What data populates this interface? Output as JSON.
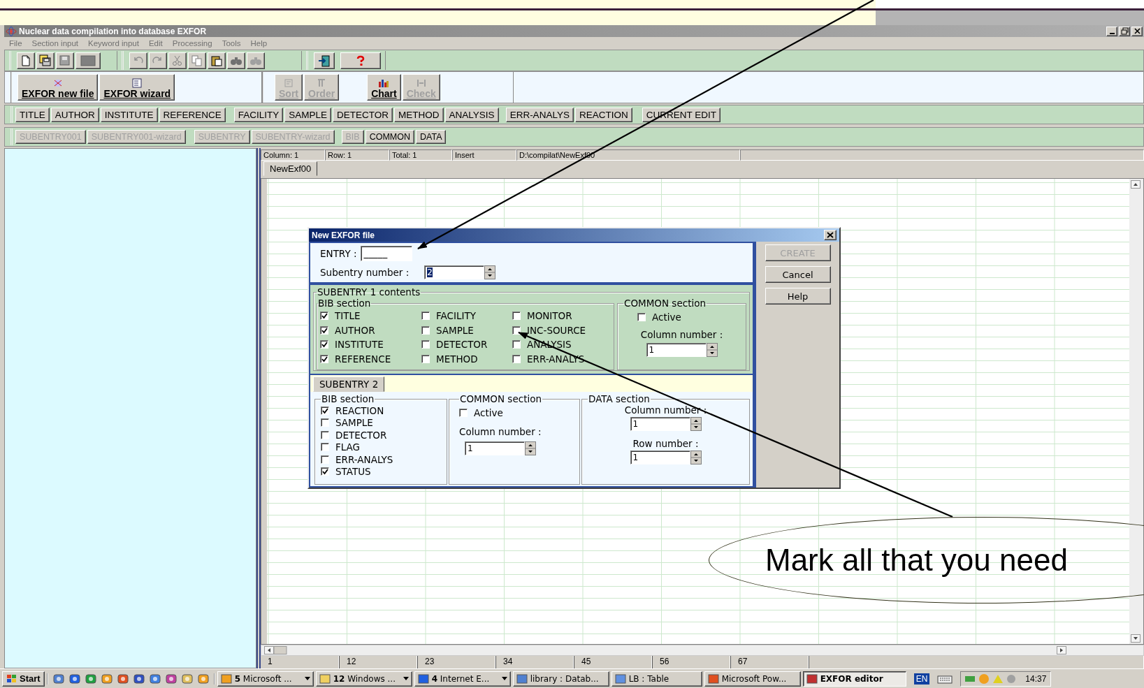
{
  "window": {
    "title": "Nuclear data compilation into database EXFOR"
  },
  "menu": [
    "File",
    "Section input",
    "Keyword input",
    "Edit",
    "Processing",
    "Tools",
    "Help"
  ],
  "main_toolbar": [
    {
      "label": "EXFOR new file",
      "disabled": false
    },
    {
      "label": "EXFOR wizard",
      "disabled": false
    },
    {
      "label": "Sort",
      "disabled": true
    },
    {
      "label": "Order",
      "disabled": true
    },
    {
      "label": "Chart",
      "disabled": false
    },
    {
      "label": "Check",
      "disabled": true
    }
  ],
  "section_buttons": [
    {
      "label": "TITLE",
      "disabled": false
    },
    {
      "label": "AUTHOR",
      "disabled": false
    },
    {
      "label": "INSTITUTE",
      "disabled": false
    },
    {
      "label": "REFERENCE",
      "disabled": false
    },
    {
      "label": "FACILITY",
      "disabled": false
    },
    {
      "label": "SAMPLE",
      "disabled": false
    },
    {
      "label": "DETECTOR",
      "disabled": false
    },
    {
      "label": "METHOD",
      "disabled": false
    },
    {
      "label": "ANALYSIS",
      "disabled": false
    },
    {
      "label": "ERR-ANALYS",
      "disabled": false
    },
    {
      "label": "REACTION",
      "disabled": false
    },
    {
      "label": "CURRENT EDIT",
      "disabled": false
    }
  ],
  "subentry_buttons": [
    {
      "label": "SUBENTRY001",
      "disabled": true
    },
    {
      "label": "SUBENTRY001-wizard",
      "disabled": true
    },
    {
      "label": "SUBENTRY",
      "disabled": true
    },
    {
      "label": "SUBENTRY-wizard",
      "disabled": true
    },
    {
      "label": "BIB",
      "disabled": true
    },
    {
      "label": "COMMON",
      "disabled": false
    },
    {
      "label": "DATA",
      "disabled": false
    }
  ],
  "status_bar": [
    "Column: 1",
    "Row: 1",
    "Total: 1",
    "Insert",
    "D:\\compilat\\NewExf00"
  ],
  "document_tab": "NewExf00",
  "ruler": [
    "1",
    "12",
    "23",
    "34",
    "45",
    "56",
    "67"
  ],
  "dialog": {
    "title": "New EXFOR file",
    "entry": {
      "label": "ENTRY :",
      "value": "_____"
    },
    "subentry_number": {
      "label": "Subentry number :",
      "value": "2"
    },
    "buttons": [
      {
        "label": "CREATE",
        "disabled": true
      },
      {
        "label": "Cancel",
        "disabled": false
      },
      {
        "label": "Help",
        "disabled": false
      }
    ],
    "subentry1": {
      "title": "SUBENTRY 1 contents",
      "bib": {
        "title": "BIB section",
        "items": [
          {
            "label": "TITLE",
            "checked": true
          },
          {
            "label": "AUTHOR",
            "checked": true
          },
          {
            "label": "INSTITUTE",
            "checked": true
          },
          {
            "label": "REFERENCE",
            "checked": true
          },
          {
            "label": "FACILITY",
            "checked": false
          },
          {
            "label": "SAMPLE",
            "checked": false
          },
          {
            "label": "DETECTOR",
            "checked": false
          },
          {
            "label": "METHOD",
            "checked": false
          },
          {
            "label": "MONITOR",
            "checked": false
          },
          {
            "label": "INC-SOURCE",
            "checked": false
          },
          {
            "label": "ANALYSIS",
            "checked": false
          },
          {
            "label": "ERR-ANALYS",
            "checked": false
          }
        ]
      },
      "common": {
        "title": "COMMON section",
        "active": {
          "label": "Active",
          "checked": false
        },
        "column_label": "Column number :",
        "column_value": "1"
      }
    },
    "subentry2": {
      "tab": "SUBENTRY 2",
      "bib": {
        "title": "BIB section",
        "items": [
          {
            "label": "REACTION",
            "checked": true
          },
          {
            "label": "SAMPLE",
            "checked": false
          },
          {
            "label": "DETECTOR",
            "checked": false
          },
          {
            "label": "FLAG",
            "checked": false
          },
          {
            "label": "ERR-ANALYS",
            "checked": false
          },
          {
            "label": "STATUS",
            "checked": true
          }
        ]
      },
      "common": {
        "title": "COMMON section",
        "active": {
          "label": "Active",
          "checked": false
        },
        "column_label": "Column number :",
        "column_value": "1"
      },
      "data": {
        "title": "DATA section",
        "column_label": "Column number :",
        "column_value": "1",
        "row_label": "Row number :",
        "row_value": "1"
      }
    }
  },
  "taskbar": {
    "start": "Start",
    "tasks": [
      {
        "label": "**5** Microsoft ...",
        "selected": false
      },
      {
        "label": "**12** Windows ...",
        "selected": false
      },
      {
        "label": "**4** Internet E...",
        "selected": false
      },
      {
        "label": "library : Datab...",
        "selected": false
      },
      {
        "label": "LB : Table",
        "selected": false
      },
      {
        "label": "Microsoft Pow...",
        "selected": false
      },
      {
        "label": "EXFOR editor",
        "selected": true
      }
    ],
    "language": "EN",
    "clock": "14:37"
  },
  "slide_callout": {
    "text": "Mark all that you need"
  }
}
